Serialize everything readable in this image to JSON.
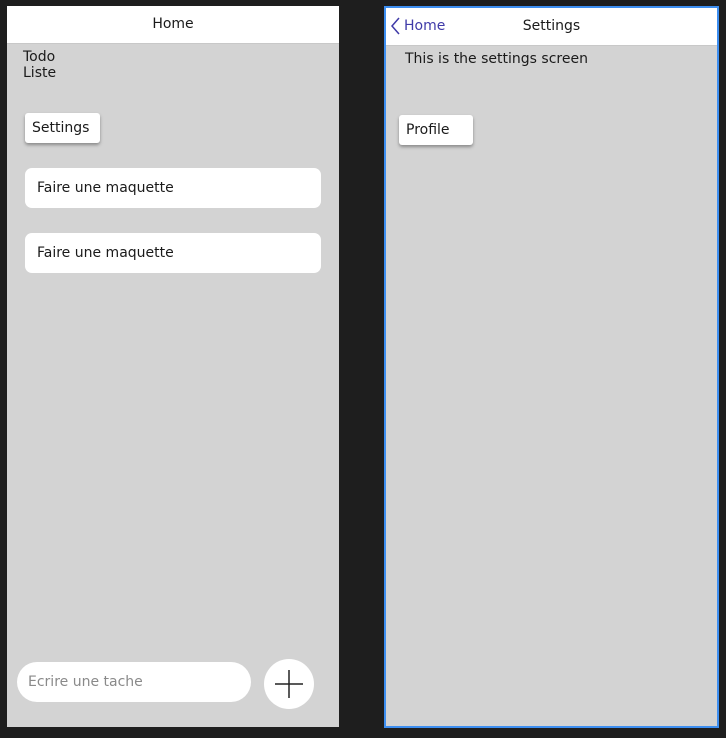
{
  "home_screen": {
    "nav_title": "Home",
    "todo_title_line1": "Todo",
    "todo_title_line2": "Liste",
    "settings_button_label": "Settings",
    "tasks": [
      {
        "label": "Faire une maquette"
      },
      {
        "label": "Faire une maquette"
      }
    ],
    "input_placeholder": "Ecrire une tache",
    "add_button_icon": "plus-icon"
  },
  "settings_screen": {
    "back_label": "Home",
    "back_icon": "chevron-left-icon",
    "nav_title": "Settings",
    "description": "This is the settings screen",
    "profile_button_label": "Profile"
  },
  "colors": {
    "background": "#1e1e1e",
    "screen_background": "#d3d3d3",
    "selected_frame_border": "#3d8ef0",
    "back_link": "#3f3aa8"
  }
}
